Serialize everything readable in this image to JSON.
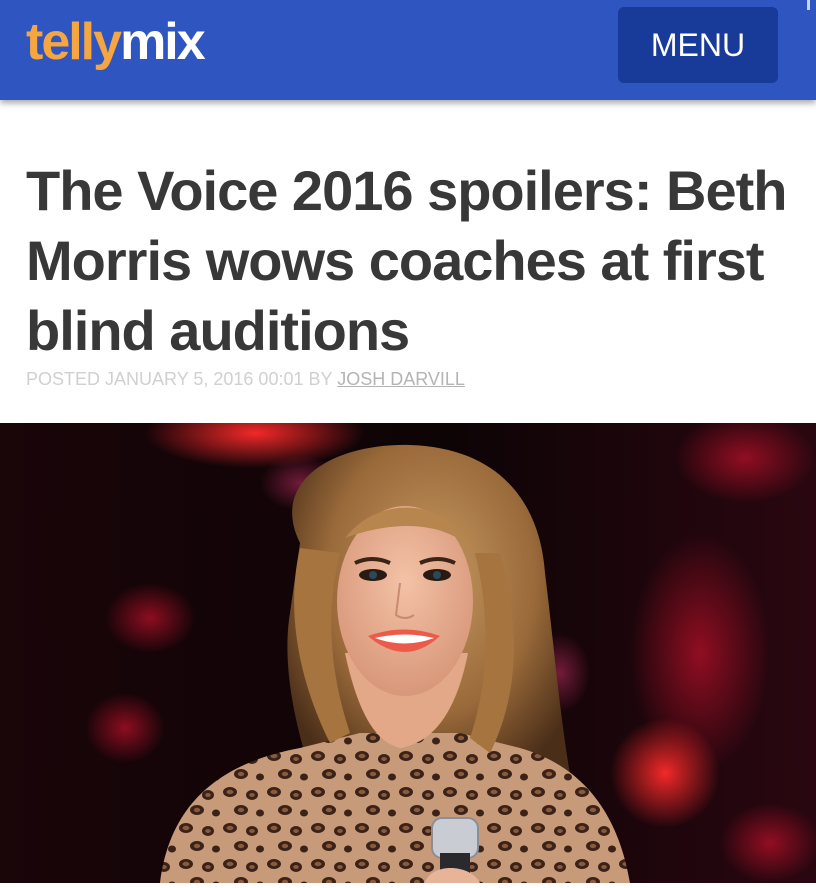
{
  "header": {
    "logo_part1": "telly",
    "logo_part2": "mix",
    "menu_label": "MENU"
  },
  "article": {
    "title": "The Voice 2016 spoilers: Beth Morris wows coaches at first blind auditions",
    "posted_label": "POSTED JANUARY 5, 2016 00:01 BY",
    "author": "JOSH DARVILL"
  },
  "colors": {
    "header_bg": "#2f55c0",
    "menu_bg": "#183a99",
    "logo_accent": "#f5a640",
    "headline": "#383838"
  }
}
